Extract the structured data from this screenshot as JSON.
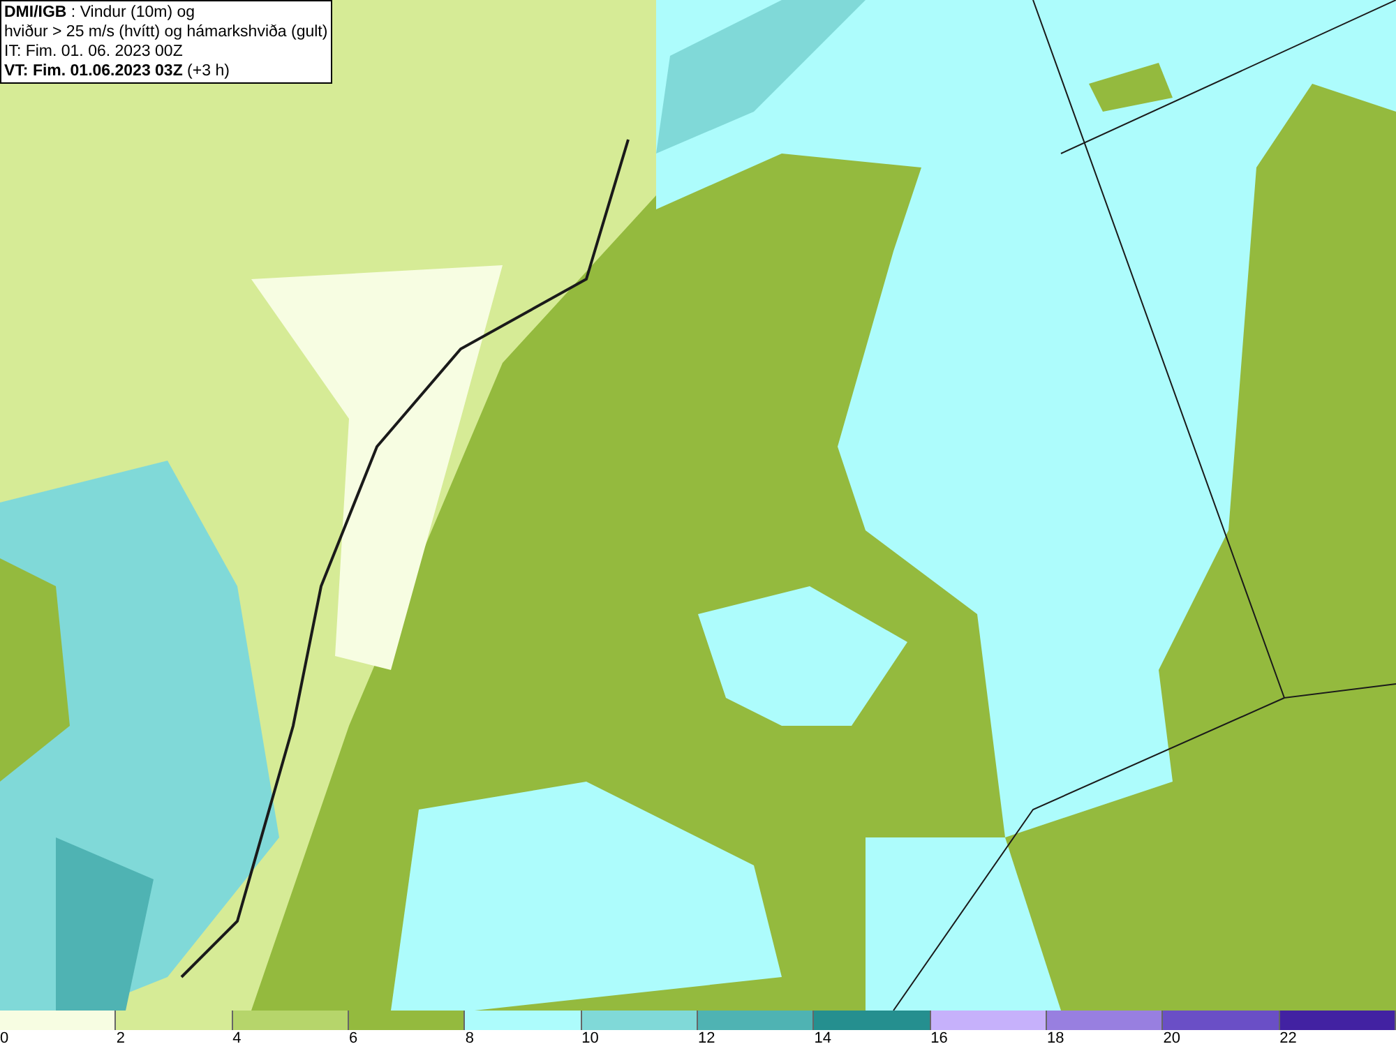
{
  "header": {
    "lines": [
      "**DMI/IGB** : Vindur (10m) og",
      "hviður > 25 m/s (hvítt) og hámarkshviða (gult)",
      "IT: Fim. 01. 06. 2023 00Z",
      "**VT: Fim. 01.06.2023 03Z** (+3 h)"
    ]
  },
  "legend": [
    {
      "label": "0",
      "color": "#f7fde2"
    },
    {
      "label": "2",
      "color": "#d6eb96"
    },
    {
      "label": "4",
      "color": "#b6d56b"
    },
    {
      "label": "6",
      "color": "#94ba3e"
    },
    {
      "label": "8",
      "color": "#adfcfc"
    },
    {
      "label": "10",
      "color": "#80d9d8"
    },
    {
      "label": "12",
      "color": "#4fb3b3"
    },
    {
      "label": "14",
      "color": "#258f8f"
    },
    {
      "label": "16",
      "color": "#c6b1fb"
    },
    {
      "label": "18",
      "color": "#987fe0"
    },
    {
      "label": "20",
      "color": "#6a4fc6"
    },
    {
      "label": "22",
      "color": "#4222a2"
    }
  ]
}
